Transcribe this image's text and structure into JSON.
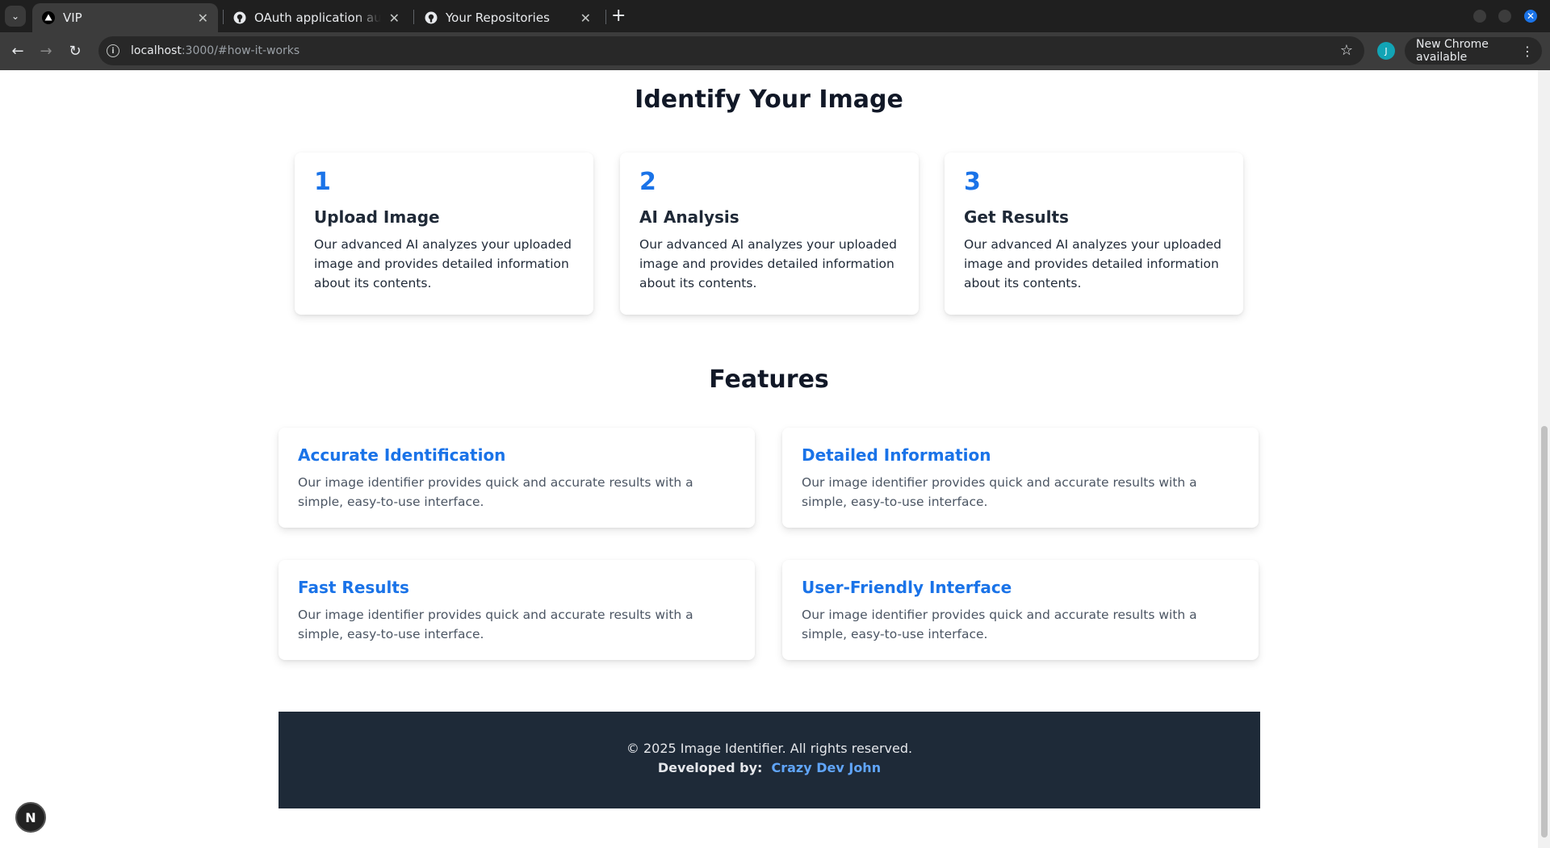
{
  "browser": {
    "tabs": [
      {
        "title": "VIP",
        "active": true,
        "icon": "triangle-logo-icon"
      },
      {
        "title": "OAuth application autho",
        "active": false,
        "icon": "github-icon"
      },
      {
        "title": "Your Repositories",
        "active": false,
        "icon": "github-icon"
      }
    ],
    "url_host": "localhost",
    "url_rest": ":3000/#how-it-works",
    "profile_initial": "J",
    "update_label": "New Chrome available"
  },
  "how_it_works": {
    "title": "Identify Your Image",
    "steps": [
      {
        "number": "1",
        "title": "Upload Image",
        "description": "Our advanced AI analyzes your uploaded image and provides detailed information about its contents."
      },
      {
        "number": "2",
        "title": "AI Analysis",
        "description": "Our advanced AI analyzes your uploaded image and provides detailed information about its contents."
      },
      {
        "number": "3",
        "title": "Get Results",
        "description": "Our advanced AI analyzes your uploaded image and provides detailed information about its contents."
      }
    ]
  },
  "features": {
    "title": "Features",
    "items": [
      {
        "title": "Accurate Identification",
        "description": "Our image identifier provides quick and accurate results with a simple, easy-to-use interface."
      },
      {
        "title": "Detailed Information",
        "description": "Our image identifier provides quick and accurate results with a simple, easy-to-use interface."
      },
      {
        "title": "Fast Results",
        "description": "Our image identifier provides quick and accurate results with a simple, easy-to-use interface."
      },
      {
        "title": "User-Friendly Interface",
        "description": "Our image identifier provides quick and accurate results with a simple, easy-to-use interface."
      }
    ]
  },
  "footer": {
    "copyright": "© 2025 Image Identifier. All rights reserved.",
    "developed_label": "Developed by:",
    "developer_name": "Crazy Dev John"
  },
  "dev_badge": "N",
  "colors": {
    "accent": "#1a73e8",
    "footer_bg": "#1e2a38",
    "link": "#60a5fa"
  }
}
